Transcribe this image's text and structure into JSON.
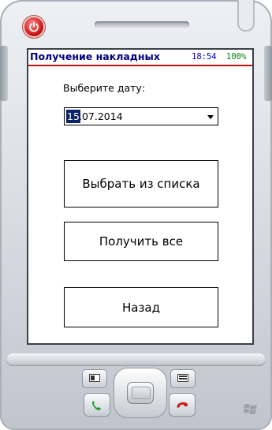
{
  "screen": {
    "title": "Получение накладных",
    "clock": "18:54",
    "battery": "100%"
  },
  "form": {
    "date_label": "Выберите дату:",
    "date_day_selected": "15",
    "date_rest": ".07.2014"
  },
  "buttons": {
    "choose_from_list": "Выбрать из списка",
    "get_all": "Получить все",
    "back": "Назад"
  },
  "icons": {
    "power": "power-icon",
    "dropdown": "chevron-down-icon",
    "call": "call-icon",
    "end_call": "end-call-icon",
    "windows": "windows-logo-icon"
  },
  "colors": {
    "title": "#000080",
    "title_underline": "#cc1111",
    "clock": "#0000cc",
    "battery": "#008000",
    "selection": "#0a246a",
    "power_button": "#d21a1a"
  }
}
